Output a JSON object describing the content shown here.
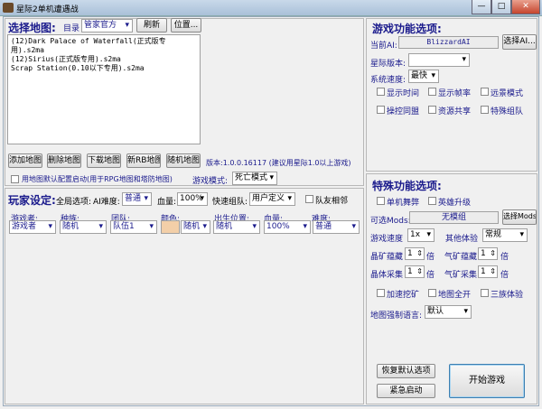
{
  "window": {
    "title": "星际2单机遭遇战",
    "minimize": "—",
    "maximize": "□",
    "close": "✕"
  },
  "map": {
    "heading": "选择地图:",
    "dir_label": "目录",
    "dir_value": "管家官方",
    "refresh": "刷新",
    "location": "位置...",
    "files": [
      "(12)Dark Palace of Waterfall(正式版专用).s2ma",
      "(12)Sirius(正式版专用).s2ma",
      "Scrap Station(0.10以下专用).s2ma"
    ],
    "buttons": [
      "添加地图",
      "删除地图",
      "下载地图",
      "新RB地图",
      "随机地图"
    ],
    "version": "版本:1.0.0.16117 (建议用星际1.0以上游戏)",
    "use_default_config": "用地图默认配置启动(用于RPG地图和塔防地图)",
    "game_mode_label": "游戏模式:",
    "game_mode": "死亡模式"
  },
  "player": {
    "heading": "玩家设定:",
    "global_label": "全局选项:",
    "ai_diff_label": "AI难度:",
    "ai_diff": "普通",
    "hp_label": "血量:",
    "hp": "100%",
    "quick_team_label": "快速组队:",
    "quick_team": "用户定义",
    "ally_adjacent": "队友相邻",
    "columns": [
      "游戏者:",
      "种族:",
      "团队:",
      "颜色:",
      "出生位置:",
      "血量:",
      "难度:"
    ],
    "row": {
      "player": "游戏者",
      "race": "随机",
      "team": "队伍1",
      "color": "随机",
      "color_swatch": "#f3cfa8",
      "spawn": "随机",
      "hp": "100%",
      "difficulty": "普通"
    }
  },
  "game_options": {
    "heading": "游戏功能选项:",
    "current_ai_label": "当前AI:",
    "current_ai": "BlizzardAI",
    "select_ai": "选择AI...",
    "sc_version_label": "星际版本:",
    "sc_version": "",
    "speed_label": "系统速度:",
    "speed": "最快",
    "checks": [
      "显示时间",
      "显示帧率",
      "远景模式",
      "操控同盟",
      "资源共享",
      "特殊组队"
    ]
  },
  "special": {
    "heading": "特殊功能选项:",
    "checks1": [
      "单机舞弊",
      "英雄升级"
    ],
    "mods_label": "可选Mods:",
    "mods": "无模组",
    "select_mods": "选择Mods",
    "game_speed_label": "游戏速度",
    "game_speed": "1x",
    "other_label": "其他体验",
    "other": "常规",
    "crystal_reserve_label": "晶矿蕴藏",
    "crystal_reserve": "1",
    "gas_reserve_label": "气矿蕴藏",
    "gas_reserve": "1",
    "crystal_gather_label": "晶体采集",
    "crystal_gather": "1",
    "gas_gather_label": "气矿采集",
    "gas_gather": "1",
    "unit": "倍",
    "checks2": [
      "加速挖矿",
      "地图全开",
      "三族体验"
    ],
    "lang_label": "地图强制语言:",
    "lang": "默认"
  },
  "actions": {
    "restore": "恢复默认选项",
    "emergency": "紧急启动",
    "start": "开始游戏"
  }
}
